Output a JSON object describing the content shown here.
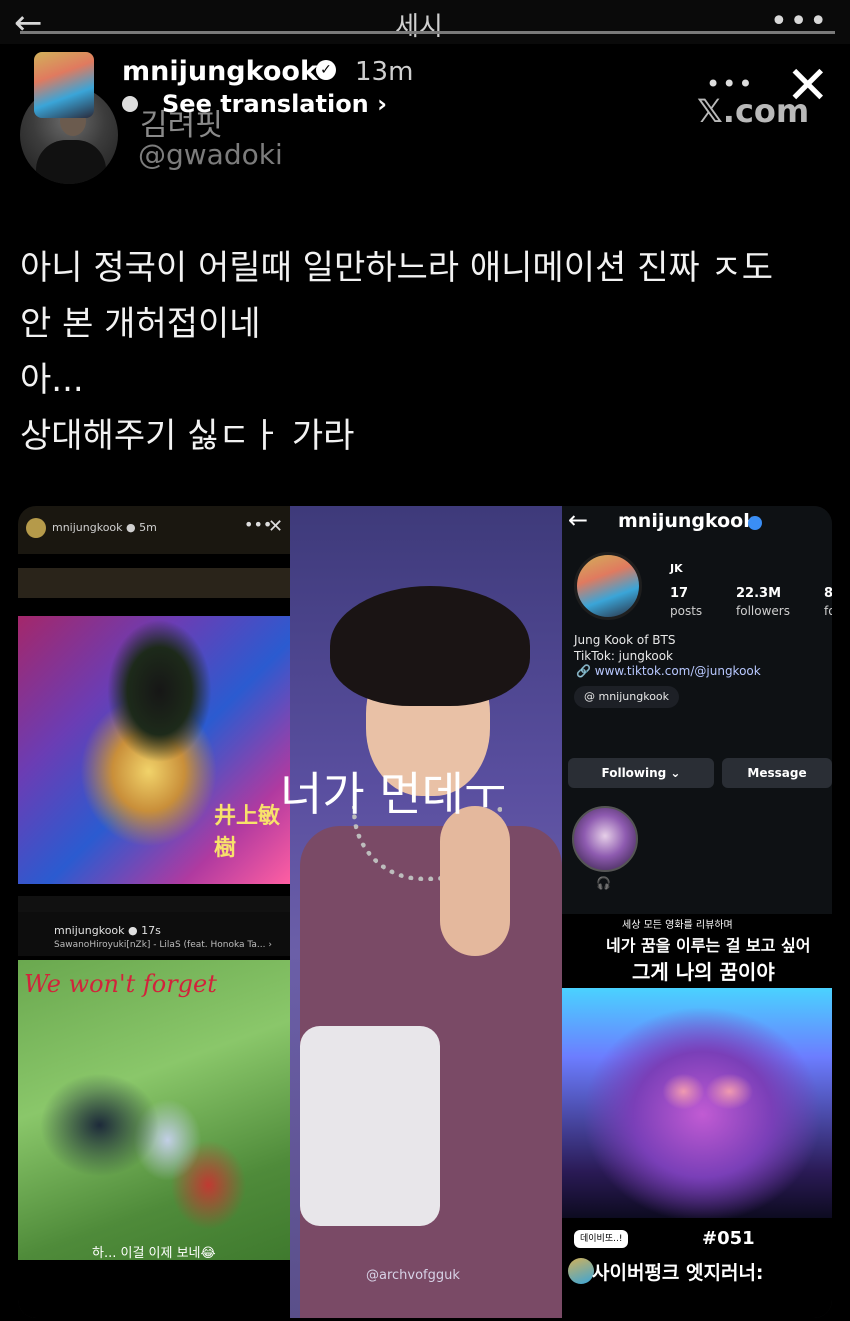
{
  "top_bar": {
    "back_icon": "arrow-left-icon",
    "title": "세시",
    "more_icon": "more-horizontal-icon"
  },
  "story_overlay": {
    "username": "mnijungkook",
    "time": "13m",
    "see_translation": "See translation",
    "chevron": "›",
    "close_icon": "close-icon",
    "menu_dots": "•••",
    "source": "𝕏.com"
  },
  "tweet": {
    "author_name": "김려핏",
    "handle": "@gwadoki",
    "lines": [
      "아니 정국이 어릴때 일만하느라 애니메이션 진짜 ㅈ도",
      "안 본 개허접이네",
      "아...",
      "상대해주기 싫ㄷㅏ 가라"
    ]
  },
  "collage": {
    "left_top": {
      "username": "mnijungkook ● 5m",
      "kanji": "井上敏樹"
    },
    "left_bottom": {
      "username": "mnijungkook ● 17s",
      "song": "SawanoHiroyuki[nZk] - LilaS (feat. Honoka Ta... ›",
      "script_text": "We won't forget",
      "caption": "하... 이걸 이제 보네😂"
    },
    "center": {
      "caption": "너가 먼데ㅜ",
      "watermark": "@archvofgguk"
    },
    "right": {
      "username": "mnijungkook",
      "name": "JK",
      "posts_count": "17",
      "posts_label": "posts",
      "followers_count": "22.3M",
      "followers_label": "followers",
      "following_count": "8",
      "following_label": "fo",
      "bio_line1": "Jung Kook of BTS",
      "bio_line2": "TikTok: jungkook",
      "link": "www.tiktok.com/@jungkook",
      "threads_pill": "mnijungkook",
      "following_button": "Following ⌄",
      "message_button": "Message",
      "highlight_icon": "headphones-icon",
      "story_small": "세상 모든 영화를 리뷰하며",
      "story_mid": "네가 꿈을 이루는 걸 보고 싶어",
      "story_big": "그게 나의 꿈이야",
      "tag": "데이비또..!",
      "episode_number": "#051",
      "episode_title": "사이버펑크 엣지러너:"
    }
  }
}
